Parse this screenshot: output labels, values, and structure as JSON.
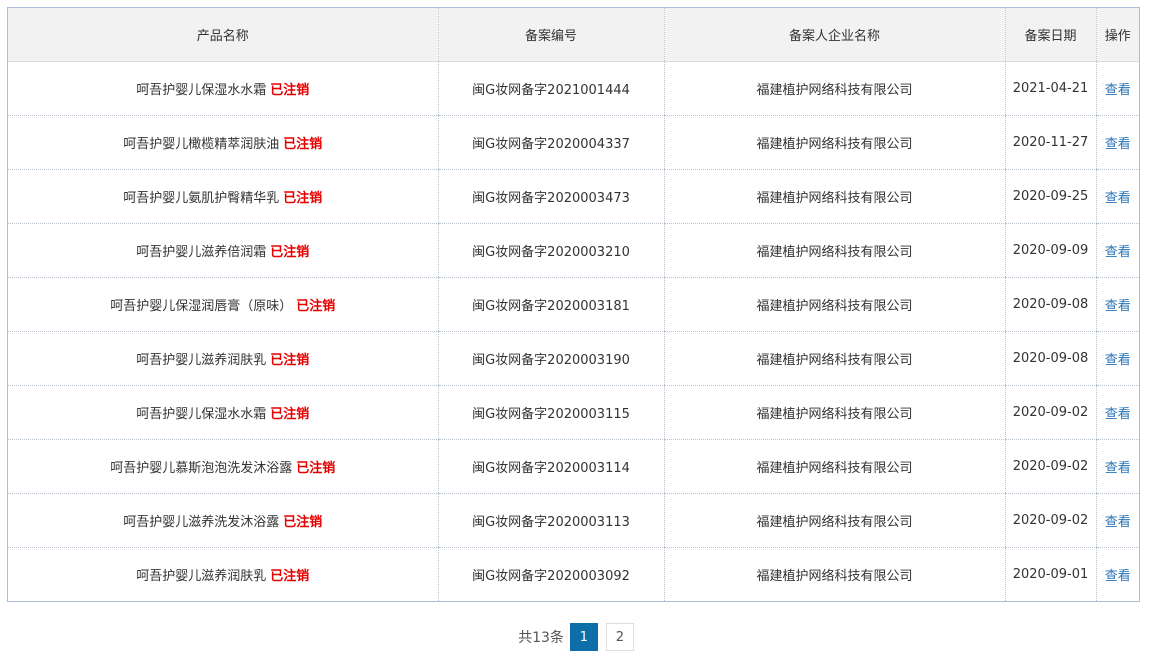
{
  "table": {
    "headers": [
      "产品名称",
      "备案编号",
      "备案人企业名称",
      "备案日期",
      "操作"
    ],
    "status_label": "已注销",
    "action_label": "查看",
    "rows": [
      {
        "name": "呵吾护婴儿保湿水水霜",
        "code": "闽G妆网备字2021001444",
        "company": "福建植护网络科技有限公司",
        "date": "2021-04-21"
      },
      {
        "name": "呵吾护婴儿橄榄精萃润肤油",
        "code": "闽G妆网备字2020004337",
        "company": "福建植护网络科技有限公司",
        "date": "2020-11-27"
      },
      {
        "name": "呵吾护婴儿氨肌护臀精华乳",
        "code": "闽G妆网备字2020003473",
        "company": "福建植护网络科技有限公司",
        "date": "2020-09-25"
      },
      {
        "name": "呵吾护婴儿滋养倍润霜",
        "code": "闽G妆网备字2020003210",
        "company": "福建植护网络科技有限公司",
        "date": "2020-09-09"
      },
      {
        "name": "呵吾护婴儿保湿润唇膏（原味）",
        "code": "闽G妆网备字2020003181",
        "company": "福建植护网络科技有限公司",
        "date": "2020-09-08"
      },
      {
        "name": "呵吾护婴儿滋养润肤乳",
        "code": "闽G妆网备字2020003190",
        "company": "福建植护网络科技有限公司",
        "date": "2020-09-08"
      },
      {
        "name": "呵吾护婴儿保湿水水霜",
        "code": "闽G妆网备字2020003115",
        "company": "福建植护网络科技有限公司",
        "date": "2020-09-02"
      },
      {
        "name": "呵吾护婴儿慕斯泡泡洗发沐浴露",
        "code": "闽G妆网备字2020003114",
        "company": "福建植护网络科技有限公司",
        "date": "2020-09-02"
      },
      {
        "name": "呵吾护婴儿滋养洗发沐浴露",
        "code": "闽G妆网备字2020003113",
        "company": "福建植护网络科技有限公司",
        "date": "2020-09-02"
      },
      {
        "name": "呵吾护婴儿滋养润肤乳",
        "code": "闽G妆网备字2020003092",
        "company": "福建植护网络科技有限公司",
        "date": "2020-09-01"
      }
    ]
  },
  "pagination": {
    "total_text": "共13条",
    "pages": [
      "1",
      "2"
    ],
    "current_page": "1"
  },
  "colors": {
    "status": "#e60000",
    "link": "#2a74b6",
    "active_page": "#0e6ea8",
    "header_bg": "#f2f2f2",
    "border": "#a9bed8"
  }
}
